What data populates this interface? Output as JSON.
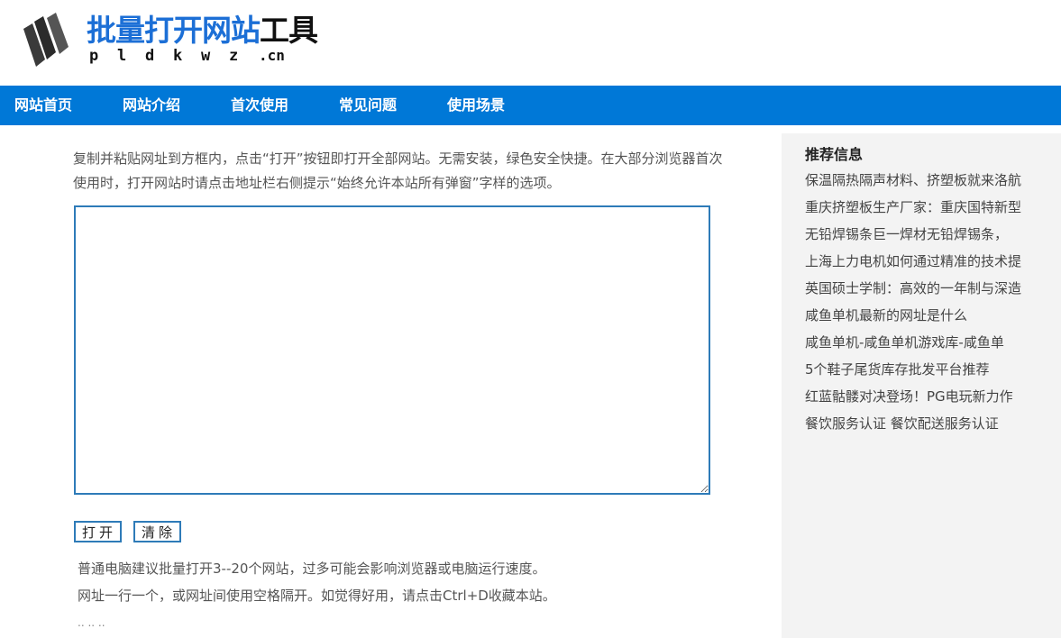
{
  "logo": {
    "title_blue": "批量打开网站",
    "title_dark": "工具",
    "sub_letters": [
      "p",
      "l",
      "d",
      "k",
      "w",
      "z"
    ],
    "sub_domain": ".cn"
  },
  "nav": {
    "items": [
      "网站首页",
      "网站介绍",
      "首次使用",
      "常见问题",
      "使用场景"
    ]
  },
  "intro": {
    "text": "复制并粘贴网址到方框内，点击“打开”按钮即打开全部网站。无需安装，绿色安全快捷。在大部分浏览器首次使用时，打开网站时请点击地址栏右侧提示“始终允许本站所有弹窗”字样的选项。"
  },
  "url_box": {
    "value": ""
  },
  "buttons": {
    "open_label": "打开",
    "clear_label": "清除"
  },
  "notes": {
    "line1": "普通电脑建议批量打开3--20个网站，过多可能会影响浏览器或电脑运行速度。",
    "line2": "网址一行一个，或网址间使用空格隔开。如觉得好用，请点击Ctrl+D收藏本站。",
    "line3": ".. .. .."
  },
  "sidebar": {
    "title": "推荐信息",
    "items": [
      "保温隔热隔声材料、挤塑板就来洛航",
      "重庆挤塑板生产厂家：重庆国特新型",
      "无铅焊锡条巨一焊材无铅焊锡条，",
      "上海上力电机如何通过精准的技术提",
      "英国硕士学制：高效的一年制与深造",
      "咸鱼单机最新的网址是什么",
      "咸鱼单机-咸鱼单机游戏库-咸鱼单",
      "5个鞋子尾货库存批发平台推荐",
      "红蓝骷髅对决登场！PG电玩新力作",
      "餐饮服务认证 餐饮配送服务认证"
    ]
  },
  "colors": {
    "nav_bg": "#0078d7",
    "logo_blue": "#1c6fd6",
    "border_blue": "#2e7bb8",
    "sidebar_bg": "#f3f3f3"
  }
}
